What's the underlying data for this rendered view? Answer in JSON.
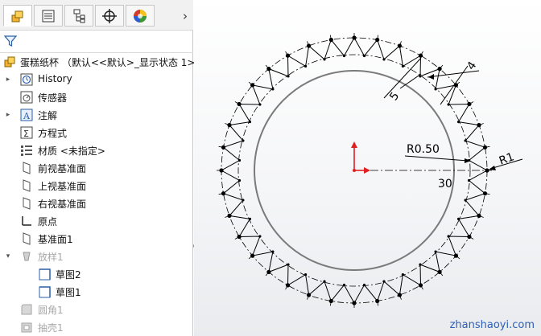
{
  "tabs": [
    {
      "name": "feature-manager-tab",
      "icon": "feature-manager-icon"
    },
    {
      "name": "property-manager-tab",
      "icon": "property-manager-icon"
    },
    {
      "name": "configuration-manager-tab",
      "icon": "configuration-manager-icon"
    },
    {
      "name": "dimxpert-tab",
      "icon": "crosshair-icon"
    },
    {
      "name": "display-manager-tab",
      "icon": "appearance-sphere-icon"
    }
  ],
  "tab_more": "›",
  "tree": {
    "root": "蛋糕纸杯 （默认<<默认>_显示状态 1>）",
    "items": [
      {
        "label": "History",
        "icon": "history-icon",
        "expander": "▸",
        "dim": false
      },
      {
        "label": "传感器",
        "icon": "sensor-icon",
        "expander": "",
        "dim": false
      },
      {
        "label": "注解",
        "icon": "annotation-icon",
        "expander": "▸",
        "dim": false
      },
      {
        "label": "方程式",
        "icon": "equation-icon",
        "expander": "",
        "dim": false
      },
      {
        "label": "材质 <未指定>",
        "icon": "material-icon",
        "expander": "",
        "dim": false
      },
      {
        "label": "前视基准面",
        "icon": "plane-icon",
        "expander": "",
        "dim": false
      },
      {
        "label": "上视基准面",
        "icon": "plane-icon",
        "expander": "",
        "dim": false
      },
      {
        "label": "右视基准面",
        "icon": "plane-icon",
        "expander": "",
        "dim": false
      },
      {
        "label": "原点",
        "icon": "origin-icon",
        "expander": "",
        "dim": false
      },
      {
        "label": "基准面1",
        "icon": "plane-icon",
        "expander": "",
        "dim": false
      },
      {
        "label": "放样1",
        "icon": "loft-icon",
        "expander": "▾",
        "dim": true
      },
      {
        "label": "草图2",
        "icon": "sketch-icon",
        "expander": "",
        "dim": false
      },
      {
        "label": "草图1",
        "icon": "sketch-icon",
        "expander": "",
        "dim": false
      },
      {
        "label": "圆角1",
        "icon": "fillet-icon",
        "expander": "",
        "dim": true
      },
      {
        "label": "抽壳1",
        "icon": "shell-icon",
        "expander": "",
        "dim": true
      }
    ]
  },
  "sketch": {
    "dims": {
      "r_small": "R0.50",
      "r_big": "R1",
      "d30": "30",
      "d4": "4",
      "d5": "5"
    }
  },
  "watermark": "zhanshaoyi.com",
  "colors": {
    "origin_red": "#e02020",
    "sketch_line": "#000000",
    "inner_circle": "#7a7a7a"
  }
}
